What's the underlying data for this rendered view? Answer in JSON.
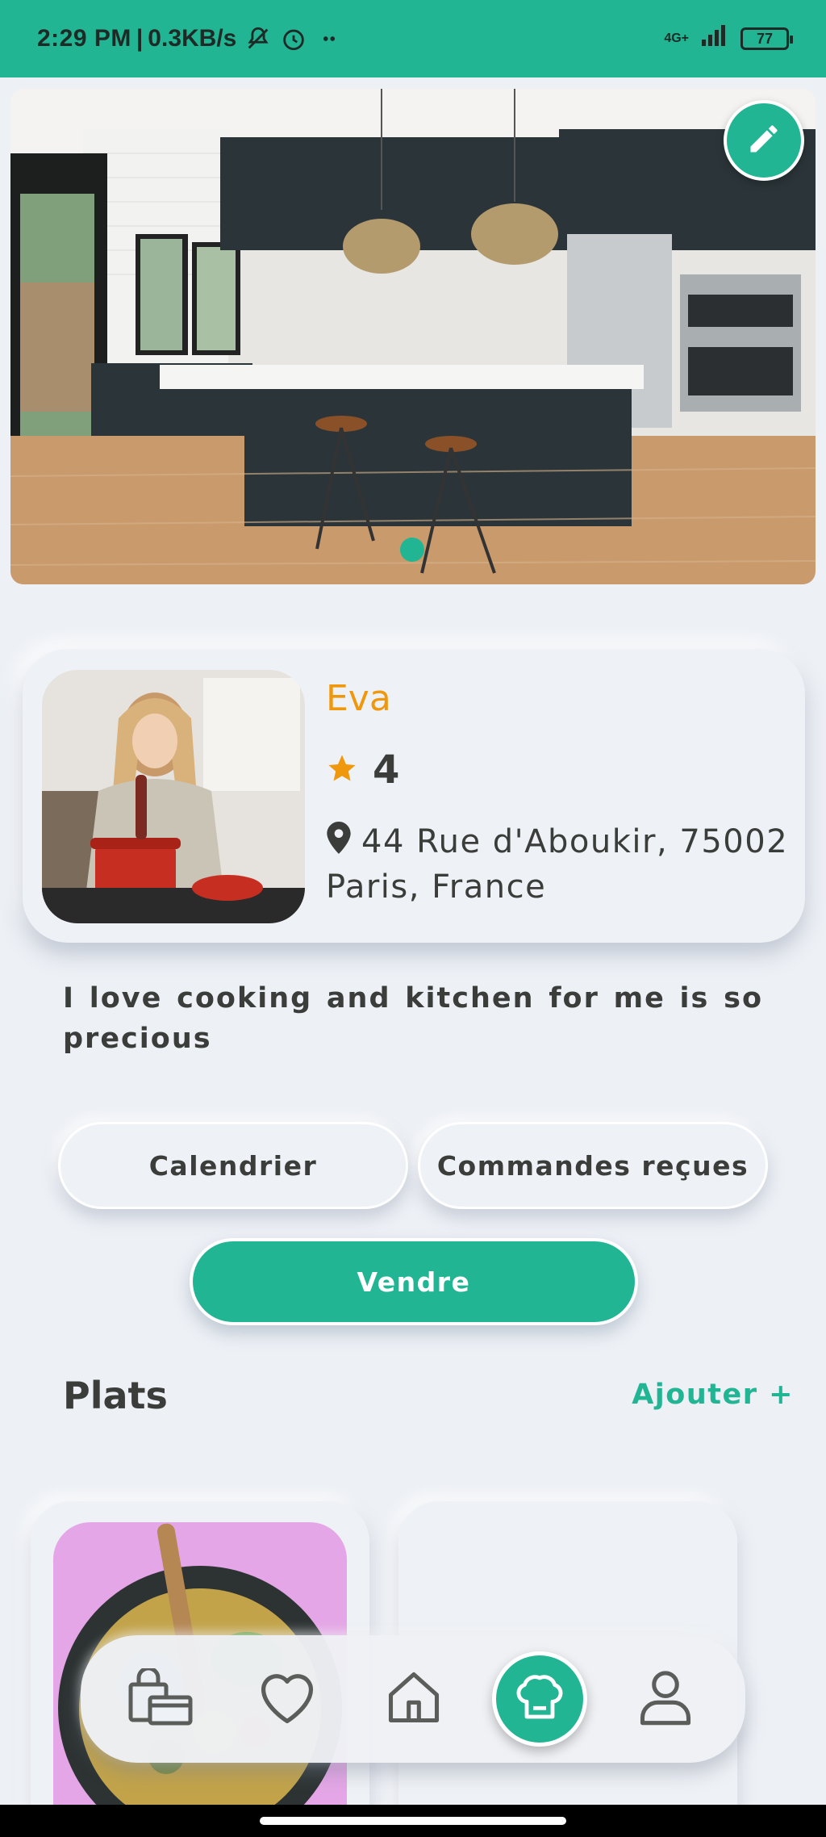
{
  "status_bar": {
    "time": "2:29 PM",
    "speed": "0.3KB/s",
    "network": "4G+",
    "battery": "77"
  },
  "profile": {
    "name": "Eva",
    "rating": "4",
    "address": "44 Rue d'Aboukir, 75002 Paris, France",
    "bio": "I love cooking and kitchen for me is so precious"
  },
  "actions": {
    "calendar_label": "Calendrier",
    "orders_label": "Commandes reçues",
    "sell_label": "Vendre"
  },
  "dishes_section": {
    "title": "Plats",
    "add_label": "Ajouter +"
  },
  "bottom_nav": {
    "items": [
      {
        "icon": "shop-bag-icon",
        "active": false
      },
      {
        "icon": "heart-icon",
        "active": false
      },
      {
        "icon": "home-icon",
        "active": false
      },
      {
        "icon": "chef-hat-icon",
        "active": true
      },
      {
        "icon": "user-icon",
        "active": false
      }
    ]
  },
  "colors": {
    "accent": "#22b594",
    "name": "#f0980d",
    "background": "#edf0f5",
    "text": "#3b3d3b"
  }
}
